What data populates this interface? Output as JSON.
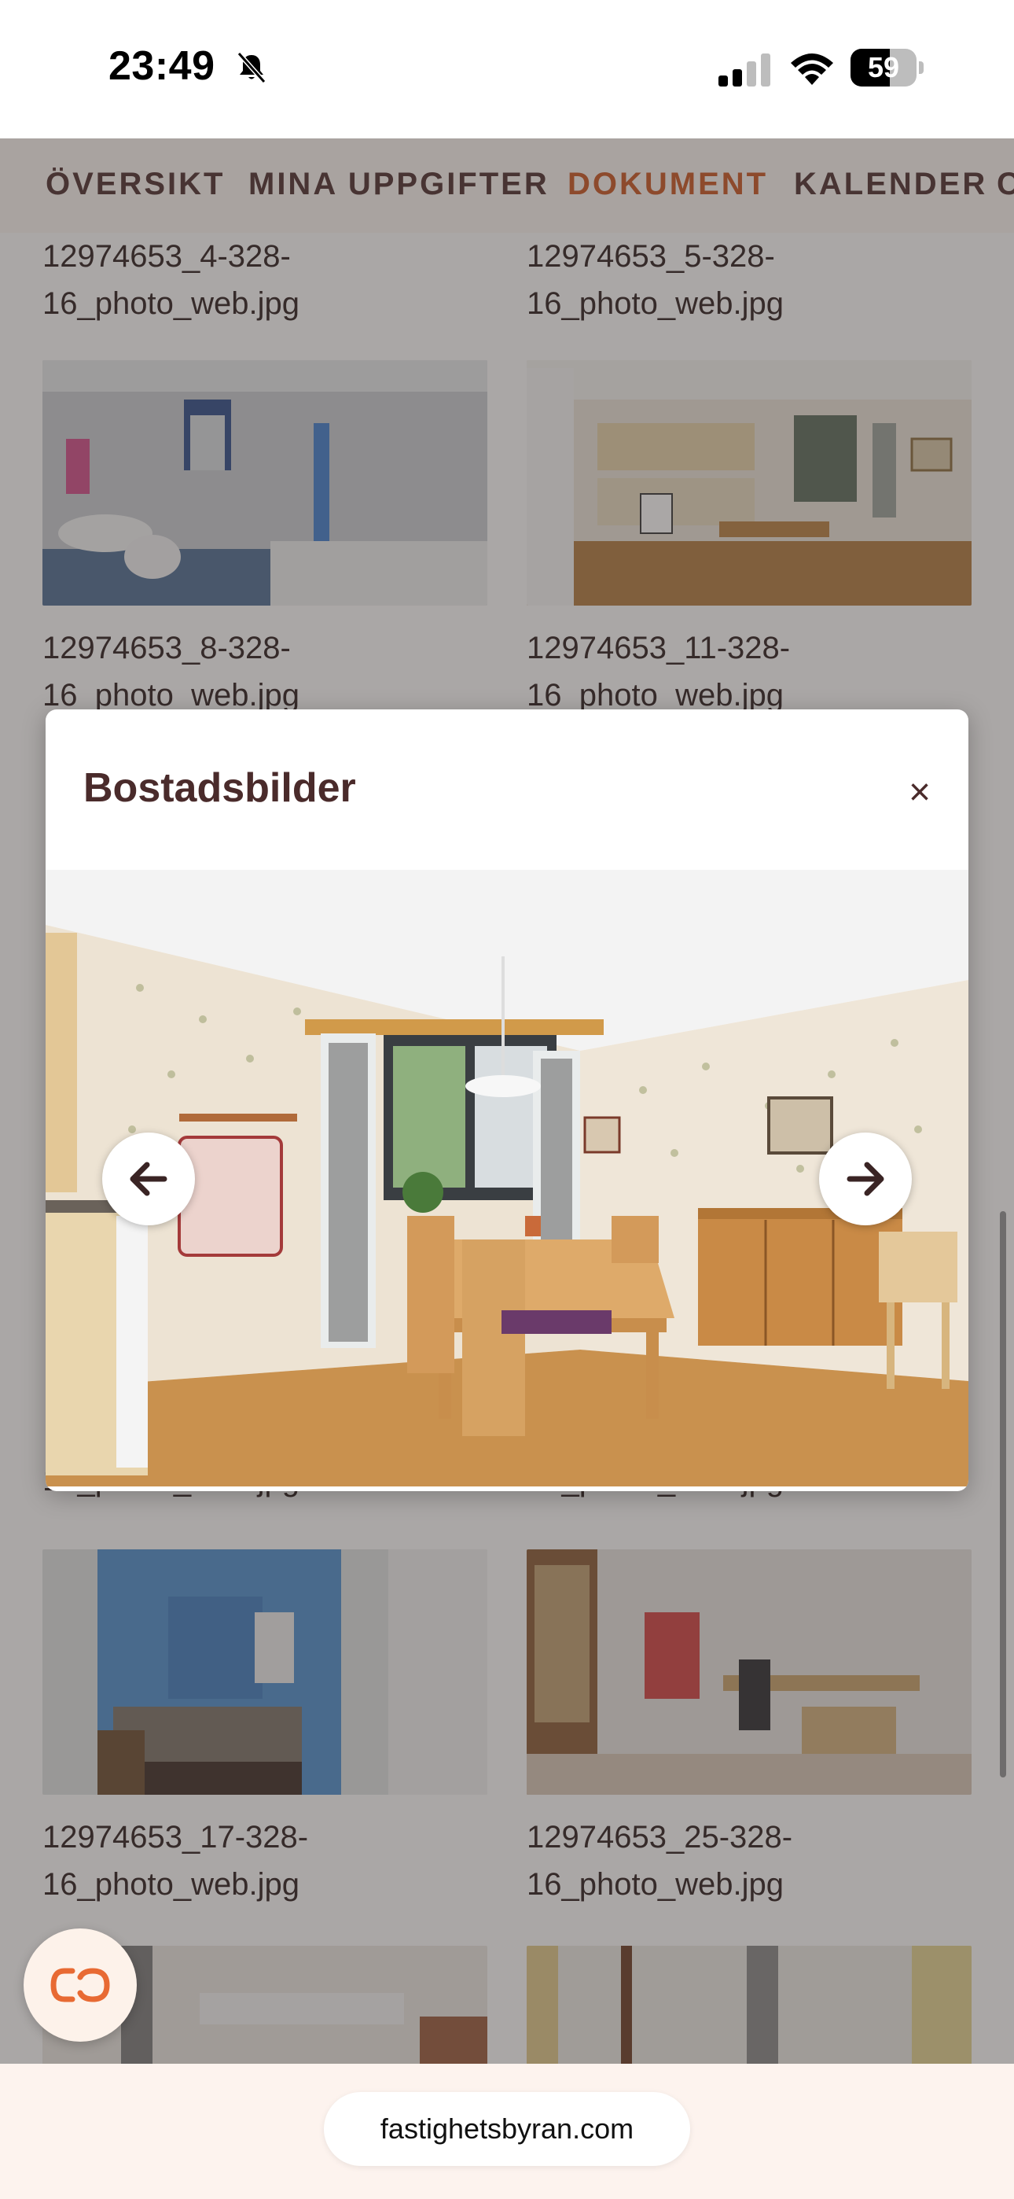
{
  "status_bar": {
    "time": "23:49",
    "battery": "59",
    "battery_level": 0.59,
    "icons": [
      "bell-muted-icon",
      "cell-signal-icon",
      "wifi-icon",
      "battery-icon"
    ]
  },
  "nav": {
    "tabs": [
      {
        "label": "ÖVERSIKT",
        "active": false
      },
      {
        "label": "MINA UPPGIFTER",
        "active": false
      },
      {
        "label": "DOKUMENT",
        "active": true
      },
      {
        "label": "KALENDER",
        "active": false
      },
      {
        "label": "C",
        "active": false
      }
    ],
    "active_color": "#c9531f"
  },
  "gallery": {
    "items": [
      {
        "label": "12974653_4-328-16_photo_web.jpg"
      },
      {
        "label": "12974653_5-328-16_photo_web.jpg"
      },
      {
        "label": "12974653_8-328-16_photo_web.jpg",
        "thumb": "bathroom"
      },
      {
        "label": "12974653_11-328-16_photo_web.jpg",
        "thumb": "kitchen"
      },
      {
        "label": "16_photo_web.jpg"
      },
      {
        "label": "16_photo_web.jpg"
      },
      {
        "label": "12974653_17-328-16_photo_web.jpg",
        "thumb": "bedroom"
      },
      {
        "label": "12974653_25-328-16_photo_web.jpg",
        "thumb": "office"
      }
    ]
  },
  "modal": {
    "title": "Bostadsbilder",
    "close_glyph": "×",
    "image_subject": "dining-room",
    "prev_icon": "arrow-left-icon",
    "next_icon": "arrow-right-icon"
  },
  "chat": {
    "icon": "chat-logo-icon",
    "color": "#e86a33"
  },
  "browser": {
    "url": "fastighetsbyran.com"
  },
  "colors": {
    "brand_dark": "#4a2b2b",
    "accent": "#c9531f"
  }
}
